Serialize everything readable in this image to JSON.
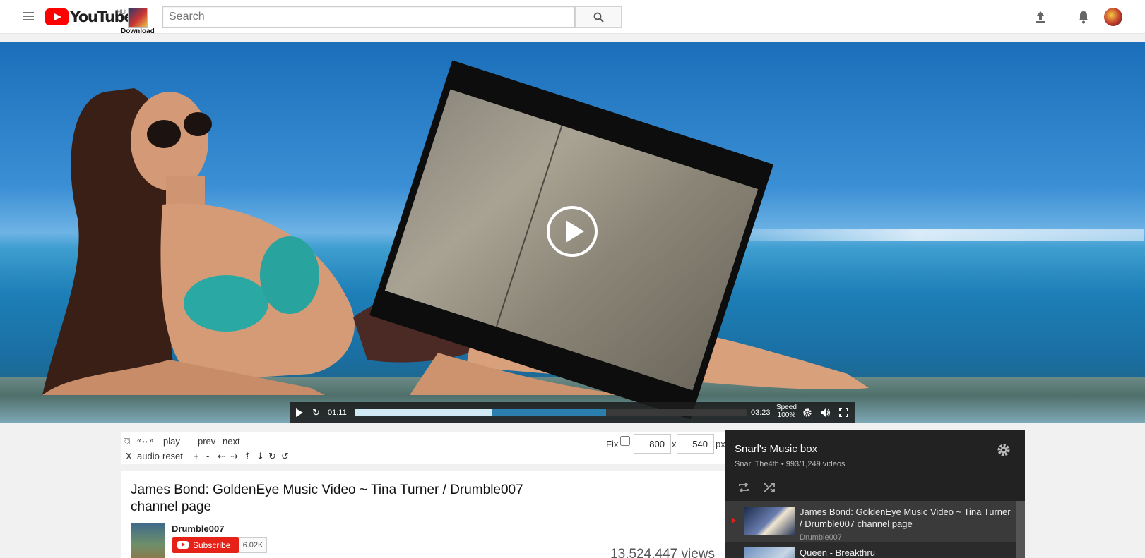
{
  "header": {
    "logo_text": "YouTube",
    "country_code": "HU",
    "download_label": "Download",
    "search": {
      "placeholder": "Search",
      "value": ""
    },
    "icons": [
      "menu-icon",
      "search-icon",
      "upload-icon",
      "bell-icon",
      "avatar"
    ]
  },
  "player": {
    "current_time": "01:11",
    "duration": "03:23",
    "speed_label": "Speed",
    "speed_value": "100%",
    "played_fraction": 0.35,
    "buffered_fraction": 0.64,
    "icons": [
      "play-icon",
      "replay-icon",
      "gear-icon",
      "volume-icon",
      "fullscreen-icon"
    ]
  },
  "toolbar": {
    "row1": {
      "filter_icon": "⛋",
      "stretch": "«↔»",
      "play": "play",
      "prev": "prev",
      "next": "next"
    },
    "row2": {
      "close": "X",
      "audio": "audio",
      "reset": "reset",
      "plus": "+",
      "minus": "-",
      "left": "⇠",
      "right": "⇢",
      "up": "⇡",
      "down": "⇣",
      "rotate_cw": "↻",
      "rotate_ccw": "↺"
    },
    "fix_label": "Fix",
    "width_value": "800",
    "times": "x",
    "height_value": "540",
    "unit": "px"
  },
  "video": {
    "title": "James Bond: GoldenEye Music Video ~ Tina Turner / Drumble007 channel page",
    "channel": "Drumble007",
    "subscribe_label": "Subscribe",
    "subscriber_count": "6.02K",
    "views": "13,524,447 views"
  },
  "playlist": {
    "title": "Snarl's Music box",
    "owner_line": "Snarl The4th • 993/1,249 videos",
    "items": [
      {
        "title": "James Bond: GoldenEye Music Video ~ Tina Turner / Drumble007 channel page",
        "channel": "Drumble007"
      },
      {
        "title": "Queen - Breakthru",
        "channel": ""
      }
    ]
  },
  "colors": {
    "brand_red": "#ff0000",
    "subscribe_red": "#e62117",
    "progress_buffer": "#2a7fae",
    "playlist_bg": "#222222"
  }
}
